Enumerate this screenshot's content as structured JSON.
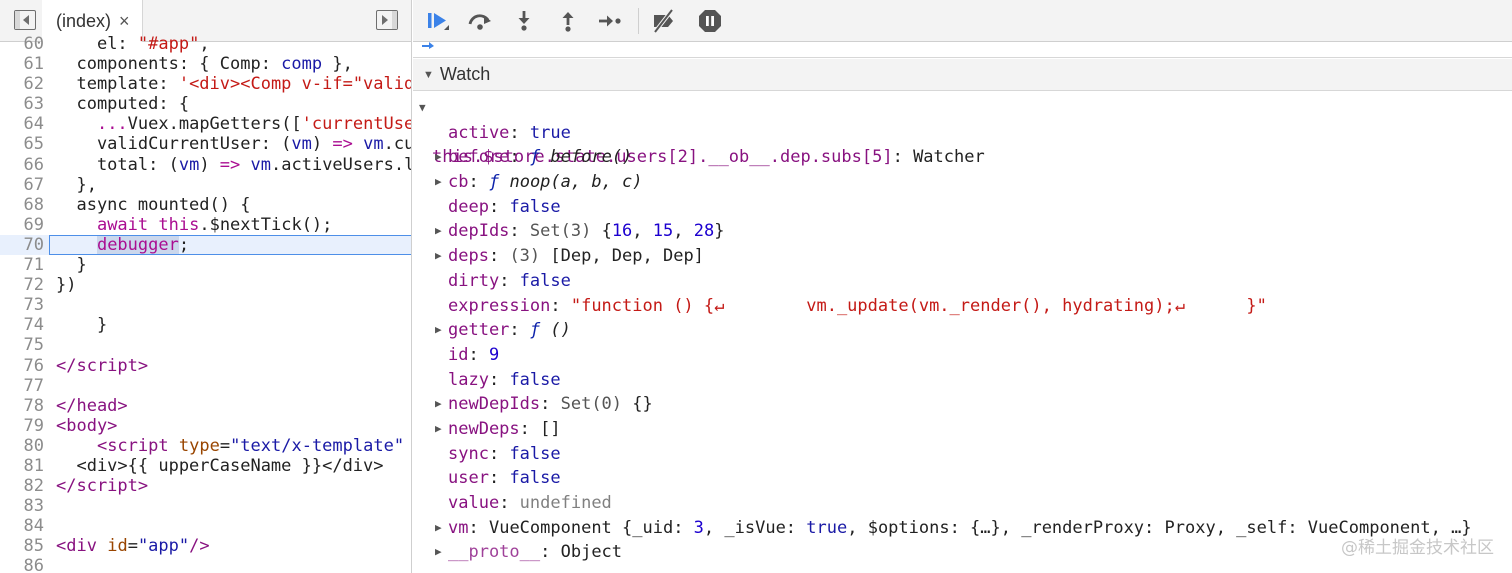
{
  "editor": {
    "tab_label": "(index)",
    "tab_close": "×"
  },
  "code_lines": [
    {
      "n": "60",
      "html": "    <span class='prop'>el: </span><span class='str'>\"#app\"</span>,"
    },
    {
      "n": "61",
      "html": "  components: { Comp: <span class='av'>comp</span> },"
    },
    {
      "n": "62",
      "html": "  template: <span class='str'>'&lt;div&gt;&lt;Comp v-if=\"valid</span>"
    },
    {
      "n": "63",
      "html": "  computed: {"
    },
    {
      "n": "64",
      "html": "    <span class='kw'>...</span>Vuex.mapGetters([<span class='str'>'currentUse</span>"
    },
    {
      "n": "65",
      "html": "    validCurrentUser: (<span class='av'>vm</span>) <span class='kw'>=&gt;</span> <span class='av'>vm</span>.cu"
    },
    {
      "n": "66",
      "html": "    total: (<span class='av'>vm</span>) <span class='kw'>=&gt;</span> <span class='av'>vm</span>.activeUsers.l"
    },
    {
      "n": "67",
      "html": "  },"
    },
    {
      "n": "68",
      "html": "  async mounted() {"
    },
    {
      "n": "69",
      "html": "    <span class='kw'>await</span> <span class='kw'>this</span>.$nextTick();"
    },
    {
      "n": "70",
      "html": "    <span class='sel'><span class='kw'>debugger</span></span>;",
      "hl": true
    },
    {
      "n": "71",
      "html": "  }"
    },
    {
      "n": "72",
      "html": "})"
    },
    {
      "n": "73",
      "html": ""
    },
    {
      "n": "74",
      "html": "    }"
    },
    {
      "n": "75",
      "html": ""
    },
    {
      "n": "76",
      "html": "<span class='tg'>&lt;/script&gt;</span>"
    },
    {
      "n": "77",
      "html": ""
    },
    {
      "n": "78",
      "html": "<span class='tg'>&lt;/head&gt;</span>"
    },
    {
      "n": "79",
      "html": "<span class='tg'>&lt;body&gt;</span>"
    },
    {
      "n": "80",
      "html": "    <span class='tg'>&lt;script</span> <span class='at'>type</span>=<span class='av'>\"text/x-template\"</span>"
    },
    {
      "n": "81",
      "html": "  &lt;div&gt;{{ upperCaseName }}&lt;/div&gt;"
    },
    {
      "n": "82",
      "html": "<span class='tg'>&lt;/script&gt;</span>"
    },
    {
      "n": "83",
      "html": ""
    },
    {
      "n": "84",
      "html": ""
    },
    {
      "n": "85",
      "html": "<span class='tg'>&lt;div</span> <span class='at'>id</span>=<span class='av'>\"app\"</span><span class='tg'>/&gt;</span>"
    },
    {
      "n": "86",
      "html": ""
    }
  ],
  "watch": {
    "title": "Watch",
    "expression": "this.$store.state.users[2].__ob__.dep.subs[5]",
    "expression_type": "Watcher",
    "props": [
      {
        "key": "active",
        "expandable": false,
        "value": "true",
        "kind": "bool"
      },
      {
        "key": "before",
        "expandable": true,
        "value_html": "<span class='f'>ƒ</span> <span class='italic'>before()</span>"
      },
      {
        "key": "cb",
        "expandable": true,
        "value_html": "<span class='f'>ƒ</span> <span class='italic'>noop(a, b, c)</span>"
      },
      {
        "key": "deep",
        "expandable": false,
        "value": "false",
        "kind": "bool"
      },
      {
        "key": "depIds",
        "expandable": true,
        "value_html": "<span class='gray'>Set(3)</span> {<span class='v-num'>16</span>, <span class='v-num'>15</span>, <span class='v-num'>28</span>}"
      },
      {
        "key": "deps",
        "expandable": true,
        "value_html": "<span class='gray'>(3)</span> [Dep, Dep, Dep]"
      },
      {
        "key": "dirty",
        "expandable": false,
        "value": "false",
        "kind": "bool"
      },
      {
        "key": "expression",
        "expandable": false,
        "value": "\"function () {↵        vm._update(vm._render(), hydrating);↵      }\"",
        "kind": "str"
      },
      {
        "key": "getter",
        "expandable": true,
        "value_html": "<span class='f'>ƒ</span> <span class='italic'>()</span>"
      },
      {
        "key": "id",
        "expandable": false,
        "value": "9",
        "kind": "num"
      },
      {
        "key": "lazy",
        "expandable": false,
        "value": "false",
        "kind": "bool"
      },
      {
        "key": "newDepIds",
        "expandable": true,
        "value_html": "<span class='gray'>Set(0)</span> {}"
      },
      {
        "key": "newDeps",
        "expandable": true,
        "value_html": "[]"
      },
      {
        "key": "sync",
        "expandable": false,
        "value": "false",
        "kind": "bool"
      },
      {
        "key": "user",
        "expandable": false,
        "value": "false",
        "kind": "bool"
      },
      {
        "key": "value",
        "expandable": false,
        "value": "undefined",
        "kind": "undef"
      },
      {
        "key": "vm",
        "expandable": true,
        "value_html": "VueComponent {_uid: <span class='v-num'>3</span>, _isVue: <span class='v-bool'>true</span>, $options: {…}, _renderProxy: Proxy, _self: VueComponent, …}"
      },
      {
        "key": "__proto__",
        "expandable": true,
        "dim": true,
        "value_html": "Object"
      }
    ]
  },
  "toolbar": {
    "resume": "resume-icon",
    "step_over": "step-over-icon",
    "step_into": "step-into-icon",
    "step_out": "step-out-icon",
    "step": "step-icon",
    "deactivate_breakpoints": "deactivate-breakpoints-icon",
    "pause_on_exceptions": "pause-on-exceptions-icon"
  },
  "watermark": "@稀土掘金技术社区"
}
